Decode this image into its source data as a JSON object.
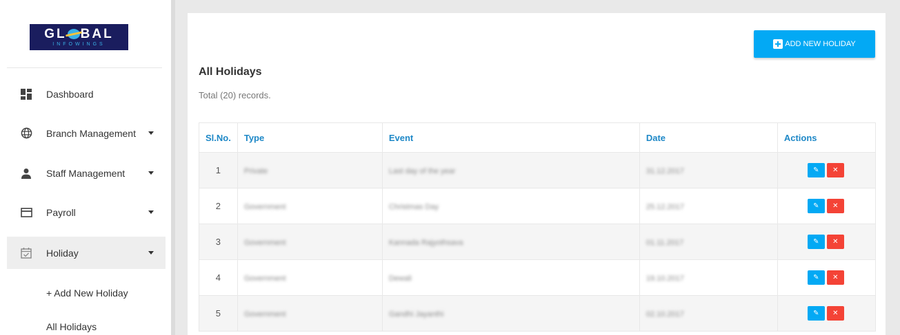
{
  "logo": {
    "main_left": "GL",
    "main_right": "BAL",
    "sub": "INFOWINGS"
  },
  "sidebar": {
    "items": [
      {
        "label": "Dashboard",
        "icon": "dashboard-icon"
      },
      {
        "label": "Branch Management",
        "icon": "globe-icon"
      },
      {
        "label": "Staff Management",
        "icon": "person-icon"
      },
      {
        "label": "Payroll",
        "icon": "payroll-icon"
      },
      {
        "label": "Holiday",
        "icon": "calendar-check-icon"
      }
    ],
    "subitems": [
      {
        "label": "+ Add New Holiday"
      },
      {
        "label": "All Holidays"
      }
    ]
  },
  "main": {
    "add_button_label": "ADD NEW HOLIDAY",
    "title": "All Holidays",
    "records": "Total (20) records.",
    "columns": [
      "Sl.No.",
      "Type",
      "Event",
      "Date",
      "Actions"
    ],
    "rows": [
      {
        "sl": "1",
        "type": "Private",
        "event": "Last day of the year",
        "date": "31.12.2017"
      },
      {
        "sl": "2",
        "type": "Government",
        "event": "Christmas Day",
        "date": "25.12.2017"
      },
      {
        "sl": "3",
        "type": "Government",
        "event": "Kannada Rajyothsava",
        "date": "01.11.2017"
      },
      {
        "sl": "4",
        "type": "Government",
        "event": "Dewali",
        "date": "19.10.2017"
      },
      {
        "sl": "5",
        "type": "Government",
        "event": "Gandhi Jayanthi",
        "date": "02.10.2017"
      }
    ]
  },
  "colors": {
    "accent": "#03a9f4",
    "danger": "#f44336",
    "header_text": "#1e88c7",
    "logo_bg": "#1a1d5e"
  }
}
